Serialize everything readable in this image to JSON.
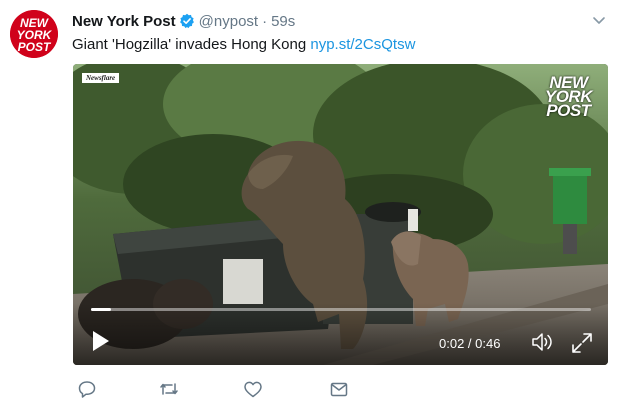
{
  "tweet": {
    "avatar_text": [
      "NEW",
      "YORK",
      "POST"
    ],
    "display_name": "New York Post",
    "verified": true,
    "handle": "@nypost",
    "separator": "·",
    "time": "59s",
    "text": "Giant 'Hogzilla' invades Hong Kong ",
    "link": "nyp.st/2CsQtsw"
  },
  "media": {
    "watermark": "Newsflare",
    "logo_lines": [
      "NEW",
      "YORK",
      "POST"
    ],
    "time_readout": "0:02 / 0:46",
    "progress": 0.04
  },
  "icons": {
    "caret": "chevron-down-icon",
    "verified": "verified-badge-icon",
    "play": "play-icon",
    "volume": "volume-icon",
    "fullscreen": "fullscreen-icon",
    "reply": "reply-icon",
    "retweet": "retweet-icon",
    "like": "heart-icon",
    "message": "envelope-icon"
  },
  "colors": {
    "brand_red": "#d0021b",
    "link": "#1b95e0",
    "muted": "#657786",
    "verified": "#1da1f2"
  }
}
